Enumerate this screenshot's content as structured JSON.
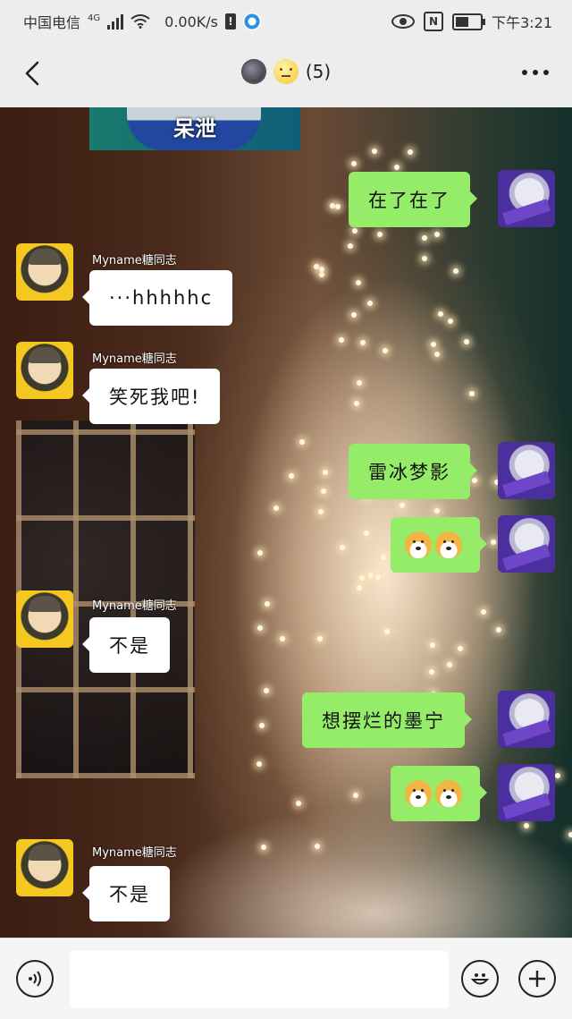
{
  "status_bar": {
    "carrier": "中国电信",
    "network": "4G",
    "speed": "0.00K/s",
    "time": "下午3:21",
    "icons": [
      "signal-icon",
      "wifi-icon",
      "warning-icon",
      "app-notification-icon",
      "eye-icon",
      "nfc-icon",
      "battery-icon"
    ],
    "battery_level": 0.55
  },
  "header": {
    "member_count": "(5)",
    "icons": [
      "back-icon",
      "new-moon-emoji-icon",
      "smiley-emoji-icon",
      "more-icon"
    ]
  },
  "banner": {
    "text": "呆泄"
  },
  "messages": [
    {
      "side": "right",
      "text": "在了在了"
    },
    {
      "side": "left",
      "sender": "Myname糖同志",
      "text": "···hhhhhc"
    },
    {
      "side": "left",
      "sender": "Myname糖同志",
      "text": "笑死我吧!"
    },
    {
      "side": "right",
      "text": "雷冰梦影"
    },
    {
      "side": "right",
      "text": "",
      "stickers": [
        "doge-emoji-icon",
        "doge-emoji-icon"
      ]
    },
    {
      "side": "left",
      "sender": "Myname糖同志",
      "text": "不是"
    },
    {
      "side": "right",
      "text": "想摆烂的墨宁"
    },
    {
      "side": "right",
      "text": "",
      "stickers": [
        "doge-emoji-icon",
        "doge-emoji-icon"
      ]
    },
    {
      "side": "left",
      "sender": "Myname糖同志",
      "text": "不是"
    }
  ],
  "input_bar": {
    "value": "",
    "icons": [
      "voice-icon",
      "emoji-icon",
      "plus-icon"
    ]
  },
  "colors": {
    "outgoing_bubble": "#95ec69",
    "incoming_bubble": "#ffffff",
    "bar_background": "#ededed"
  }
}
